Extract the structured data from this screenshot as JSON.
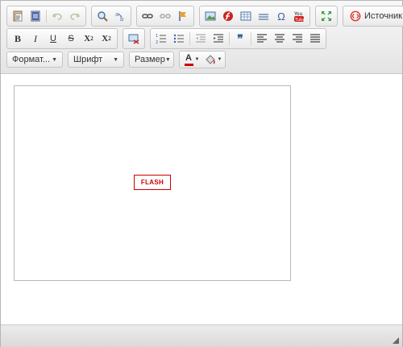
{
  "toolbar": {
    "row1": {
      "source_label": "Источник"
    },
    "row2": {
      "bold": "B",
      "italic": "I",
      "underline": "U",
      "strike": "S",
      "subscript": "X",
      "superscript": "X",
      "sub_mark": "2",
      "sup_mark": "2",
      "blockquote": "❞"
    },
    "row3": {
      "format_label": "Формат...",
      "font_label": "Шрифт",
      "size_label": "Размер",
      "text_color_label": "A"
    }
  },
  "content": {
    "flash_label": "FLASH"
  },
  "colors": {
    "flash": "#cc0000",
    "source_icon": "#d9332b",
    "text_color_bar": "#cc0000"
  }
}
